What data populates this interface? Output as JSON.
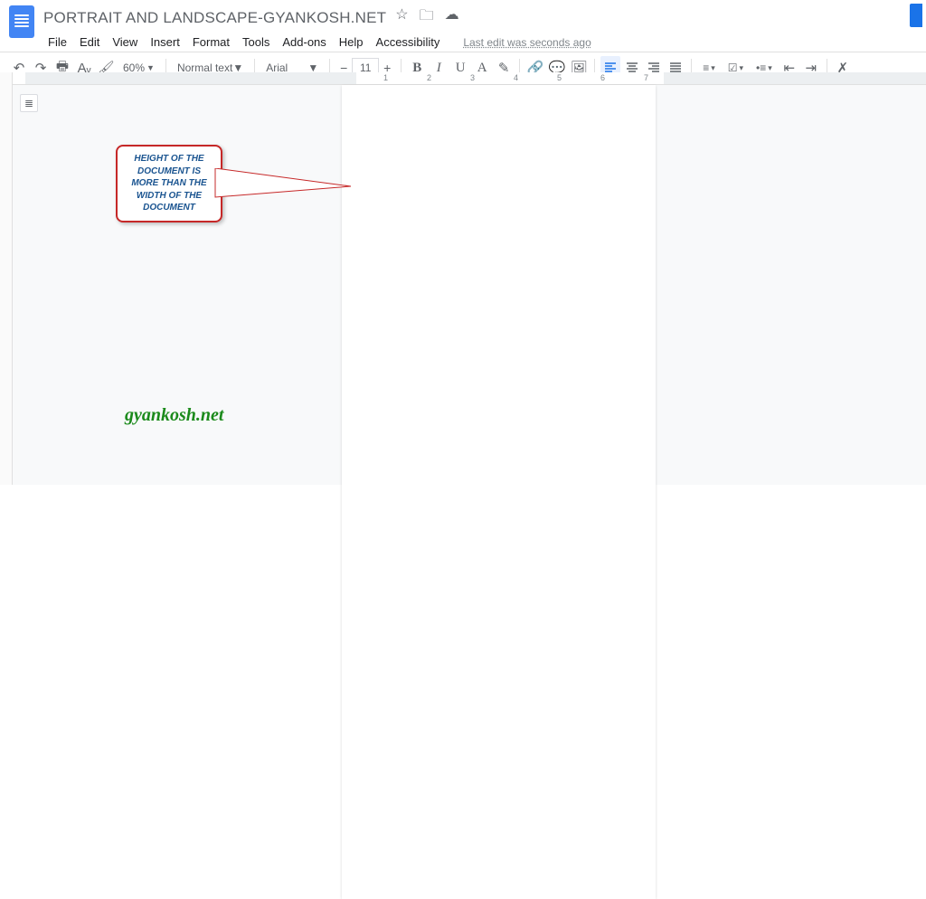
{
  "header": {
    "title": "PORTRAIT AND LANDSCAPE-GYANKOSH.NET",
    "edit_info": "Last edit was seconds ago"
  },
  "menu": {
    "file": "File",
    "edit": "Edit",
    "view": "View",
    "insert": "Insert",
    "format": "Format",
    "tools": "Tools",
    "addons": "Add-ons",
    "help": "Help",
    "accessibility": "Accessibility"
  },
  "toolbar": {
    "zoom": "60%",
    "style": "Normal text",
    "font": "Arial",
    "font_size": "11"
  },
  "ruler": {
    "n1": "1",
    "n2": "2",
    "n3": "3",
    "n4": "4",
    "n5": "5",
    "n6": "6",
    "n7": "7"
  },
  "annotation": {
    "callout_text": "HEIGHT OF THE DOCUMENT IS MORE THAN THE WIDTH OF THE DOCUMENT",
    "watermark": "gyankosh.net"
  }
}
